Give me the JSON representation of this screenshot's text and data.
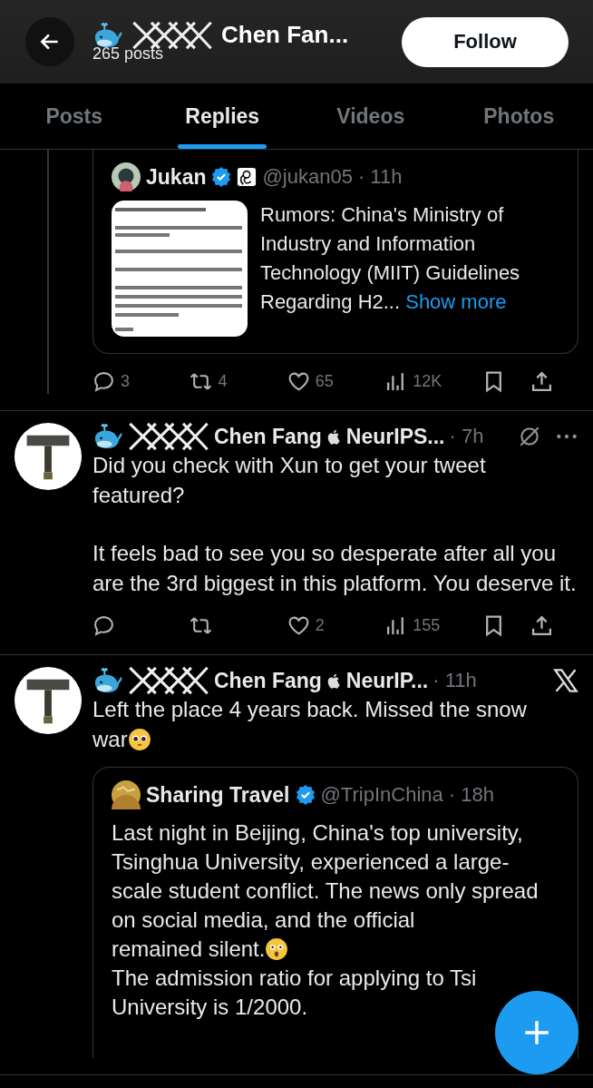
{
  "header": {
    "title": "Chen Fan...",
    "subtitle": "265 posts",
    "follow_button": "Follow"
  },
  "tabs": [
    {
      "label": "Posts",
      "selected": false
    },
    {
      "label": "Replies",
      "selected": true
    },
    {
      "label": "Videos",
      "selected": false
    },
    {
      "label": "Photos",
      "selected": false
    }
  ],
  "posts": [
    {
      "kind": "continued",
      "quote": {
        "name": "Jukan",
        "verified": true,
        "affiliate": true,
        "handle": "@jukan05",
        "time": "· 11h",
        "text": "Rumors: China's Ministry of Industry and Information Technology (MIIT) Guidelines Regarding H2...",
        "link": "Show more"
      },
      "actions": [
        {
          "kind": "reply",
          "count": "3"
        },
        {
          "kind": "repost",
          "count": "4"
        },
        {
          "kind": "like",
          "count": "65"
        },
        {
          "kind": "views",
          "count": "12K"
        },
        {
          "kind": "bookmark"
        },
        {
          "kind": "share"
        }
      ]
    },
    {
      "kind": "reply",
      "name": "Chen Fang",
      "name_suffix": "NeurIPS...",
      "time": "· 7h",
      "corner_icons": [
        {
          "kind": "slash"
        },
        {
          "kind": "more"
        }
      ],
      "paragraphs": [
        {
          "text": "Did you check with Xun to get your tweet featured?"
        },
        {
          "text": "It feels bad to see you so desperate after all you are the 3rd biggest in this platform. You deserve it."
        }
      ],
      "actions": [
        {
          "kind": "reply"
        },
        {
          "kind": "repost"
        },
        {
          "kind": "like",
          "count": "2"
        },
        {
          "kind": "views",
          "count": "155"
        },
        {
          "kind": "bookmark"
        },
        {
          "kind": "share"
        }
      ]
    },
    {
      "kind": "reply",
      "name": "Chen Fang",
      "name_suffix": "NeurIP...",
      "time": "· 11h",
      "corner_icons": [
        {
          "kind": "x"
        }
      ],
      "paragraphs": [
        {
          "text": "Left the place 4 years back. Missed the snow"
        },
        {
          "text": "war",
          "emoji": {
            "kind": "pleading"
          }
        }
      ],
      "quote": {
        "name": "Sharing Travel",
        "verified": true,
        "handle": "@TripInChina",
        "time": "· 18h",
        "paragraphs": [
          {
            "text": "Last night in Beijing, China's top university, Tsinghua University, experienced a large-scale student conflict. The news only spread on social media, and the official"
          },
          {
            "text": "remained silent.",
            "emoji": {
              "kind": "astonished"
            }
          },
          {
            "text": "The admission ratio for applying to Tsi"
          },
          {
            "text": "University is 1/2000."
          }
        ]
      }
    }
  ]
}
